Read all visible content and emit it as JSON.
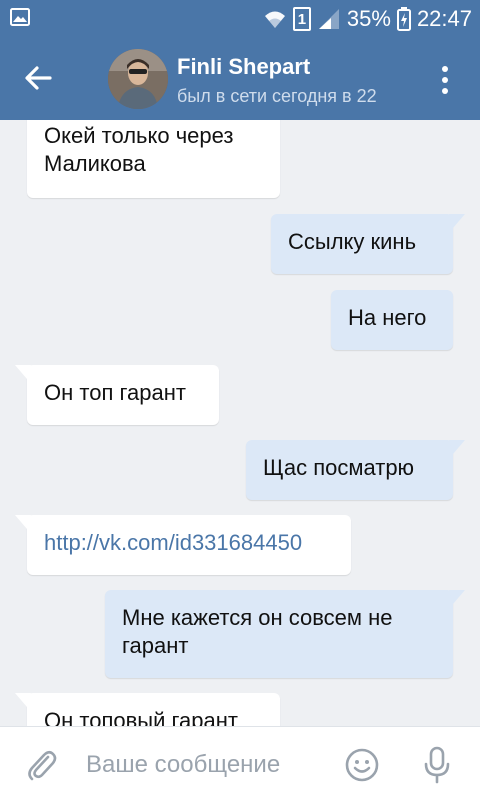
{
  "statusbar": {
    "sim": "1",
    "battery": "35%",
    "time": "22:47",
    "icons": [
      "gallery-icon",
      "wifi-icon",
      "sim-icon",
      "signal-icon",
      "battery-icon"
    ]
  },
  "header": {
    "name": "Finli Shepart",
    "status": "был в сети сегодня в 22",
    "icons": [
      "back-arrow-icon",
      "more-vertical-icon"
    ]
  },
  "messages": [
    {
      "side": "in",
      "text": "Окей только через Маликова"
    },
    {
      "side": "out",
      "text": "Ссылку кинь"
    },
    {
      "side": "out",
      "text": "На него"
    },
    {
      "side": "in",
      "text": "Он топ гарант"
    },
    {
      "side": "out",
      "text": "Щас посматрю"
    },
    {
      "side": "in",
      "text": "http://vk.com/id331684450"
    },
    {
      "side": "out",
      "text": "Мне кажется он совсем не гарант"
    },
    {
      "side": "in",
      "text": "Он топовый гарант"
    }
  ],
  "composer": {
    "placeholder": "Ваше сообщение",
    "icons": [
      "paperclip-icon",
      "smile-icon",
      "microphone-icon"
    ]
  },
  "colors": {
    "header": "#4a76a8",
    "outgoing_bubble": "#dce8f7",
    "incoming_bubble": "#ffffff",
    "chat_background": "#eef0f3",
    "link": "#4a76a8"
  }
}
